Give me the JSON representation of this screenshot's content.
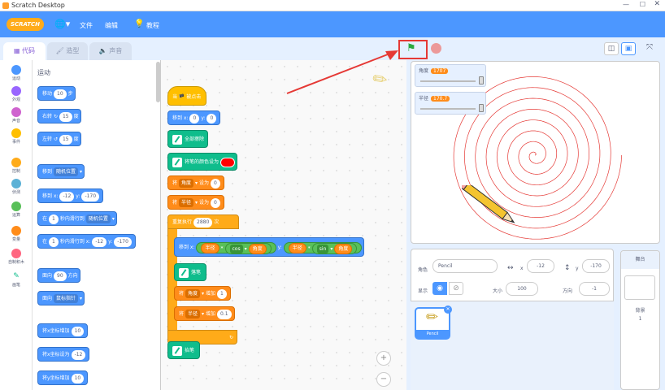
{
  "window": {
    "title": "Scratch Desktop"
  },
  "menubar": {
    "logo": "SCRATCH",
    "file": "文件",
    "edit": "编辑",
    "tutorials": "教程"
  },
  "tabs": [
    {
      "label": "代码"
    },
    {
      "label": "造型"
    },
    {
      "label": "声音"
    }
  ],
  "categories": [
    {
      "label": "运动",
      "color": "#4c97ff"
    },
    {
      "label": "外观",
      "color": "#9966ff"
    },
    {
      "label": "声音",
      "color": "#cf63cf"
    },
    {
      "label": "事件",
      "color": "#ffbf00"
    },
    {
      "label": "控制",
      "color": "#ffab19"
    },
    {
      "label": "侦测",
      "color": "#5cb1d6"
    },
    {
      "label": "运算",
      "color": "#59c059"
    },
    {
      "label": "变量",
      "color": "#ff8c1a"
    },
    {
      "label": "自制积木",
      "color": "#ff6680"
    },
    {
      "label": "画笔",
      "color": "#0fbd8c"
    }
  ],
  "palette": {
    "section_title": "运动",
    "move": {
      "text": "移动",
      "val": "10",
      "suffix": "步"
    },
    "turn_right": {
      "text": "右转",
      "val": "15",
      "suffix": "度"
    },
    "turn_left": {
      "text": "左转",
      "val": "15",
      "suffix": "度"
    },
    "goto": {
      "text": "移到",
      "dropdown": "随机位置"
    },
    "goto_xy": {
      "text": "移到 x:",
      "x": "-12",
      "ylabel": "y:",
      "y": "-170"
    },
    "glide": {
      "text": "在",
      "secs": "1",
      "mid": "秒内滑行到",
      "dropdown": "随机位置"
    },
    "glide_xy": {
      "text": "在",
      "secs": "1",
      "mid": "秒内滑行到 x:",
      "x": "-12",
      "ylabel": "y:",
      "y": "-170"
    },
    "point": {
      "text": "面向",
      "val": "90",
      "suffix": "方向"
    },
    "point_towards": {
      "text": "面向",
      "dropdown": "鼠标指针"
    },
    "change_x": {
      "text": "将x坐标增加",
      "val": "10"
    },
    "set_x": {
      "text": "将x坐标设为",
      "val": "-12"
    },
    "change_y": {
      "text": "将y坐标增加",
      "val": "10"
    }
  },
  "script": {
    "hat": "当 🏴 被点击",
    "goto": {
      "text": "移到 x:",
      "x": "0",
      "ylabel": "y:",
      "y": "0"
    },
    "clear": "全部擦除",
    "set_color": "将笔的颜色设为",
    "set_angle": {
      "t1": "将",
      "var": "角度",
      "t2": "设为",
      "val": "0"
    },
    "set_radius": {
      "t1": "将",
      "var": "半径",
      "t2": "设为",
      "val": "0"
    },
    "repeat": {
      "text": "重复执行",
      "val": "2880",
      "suffix": "次"
    },
    "inner_goto": {
      "text": "移到 x:",
      "r1": "半径",
      "mul1": "*",
      "fn1": "cos",
      "a1": "角度",
      "ylabel": "y:",
      "r2": "半径",
      "mul2": "*",
      "fn2": "sin",
      "a2": "角度"
    },
    "pen_down": "落笔",
    "change_angle": {
      "t1": "将",
      "var": "角度",
      "t2": "增加",
      "val": "1"
    },
    "change_radius": {
      "t1": "将",
      "var": "半径",
      "t2": "增加",
      "val": "0.1"
    },
    "pen_up": "抬笔",
    "repeat_arrow": "↻"
  },
  "monitors": [
    {
      "name": "角度",
      "value": "1707"
    },
    {
      "name": "半径",
      "value": "170.7"
    }
  ],
  "sprite_info": {
    "sprite_label": "角色",
    "sprite_name": "Pencil",
    "x_label": "x",
    "x": "-12",
    "y_label": "y",
    "y": "-170",
    "show_label": "显示",
    "size_label": "大小",
    "size": "100",
    "direction_label": "方向",
    "direction": "-1"
  },
  "sprite_tile": {
    "name": "Pencil"
  },
  "stage_panel": {
    "title": "舞台",
    "backdrops_label": "背景",
    "backdrops_count": "1"
  },
  "colors": {
    "menubar": "#4c97ff",
    "highlight_box": "#e53935",
    "arrow": "#e53935",
    "spiral": "#e53935"
  },
  "zoom": {
    "in": "+",
    "out": "−"
  }
}
